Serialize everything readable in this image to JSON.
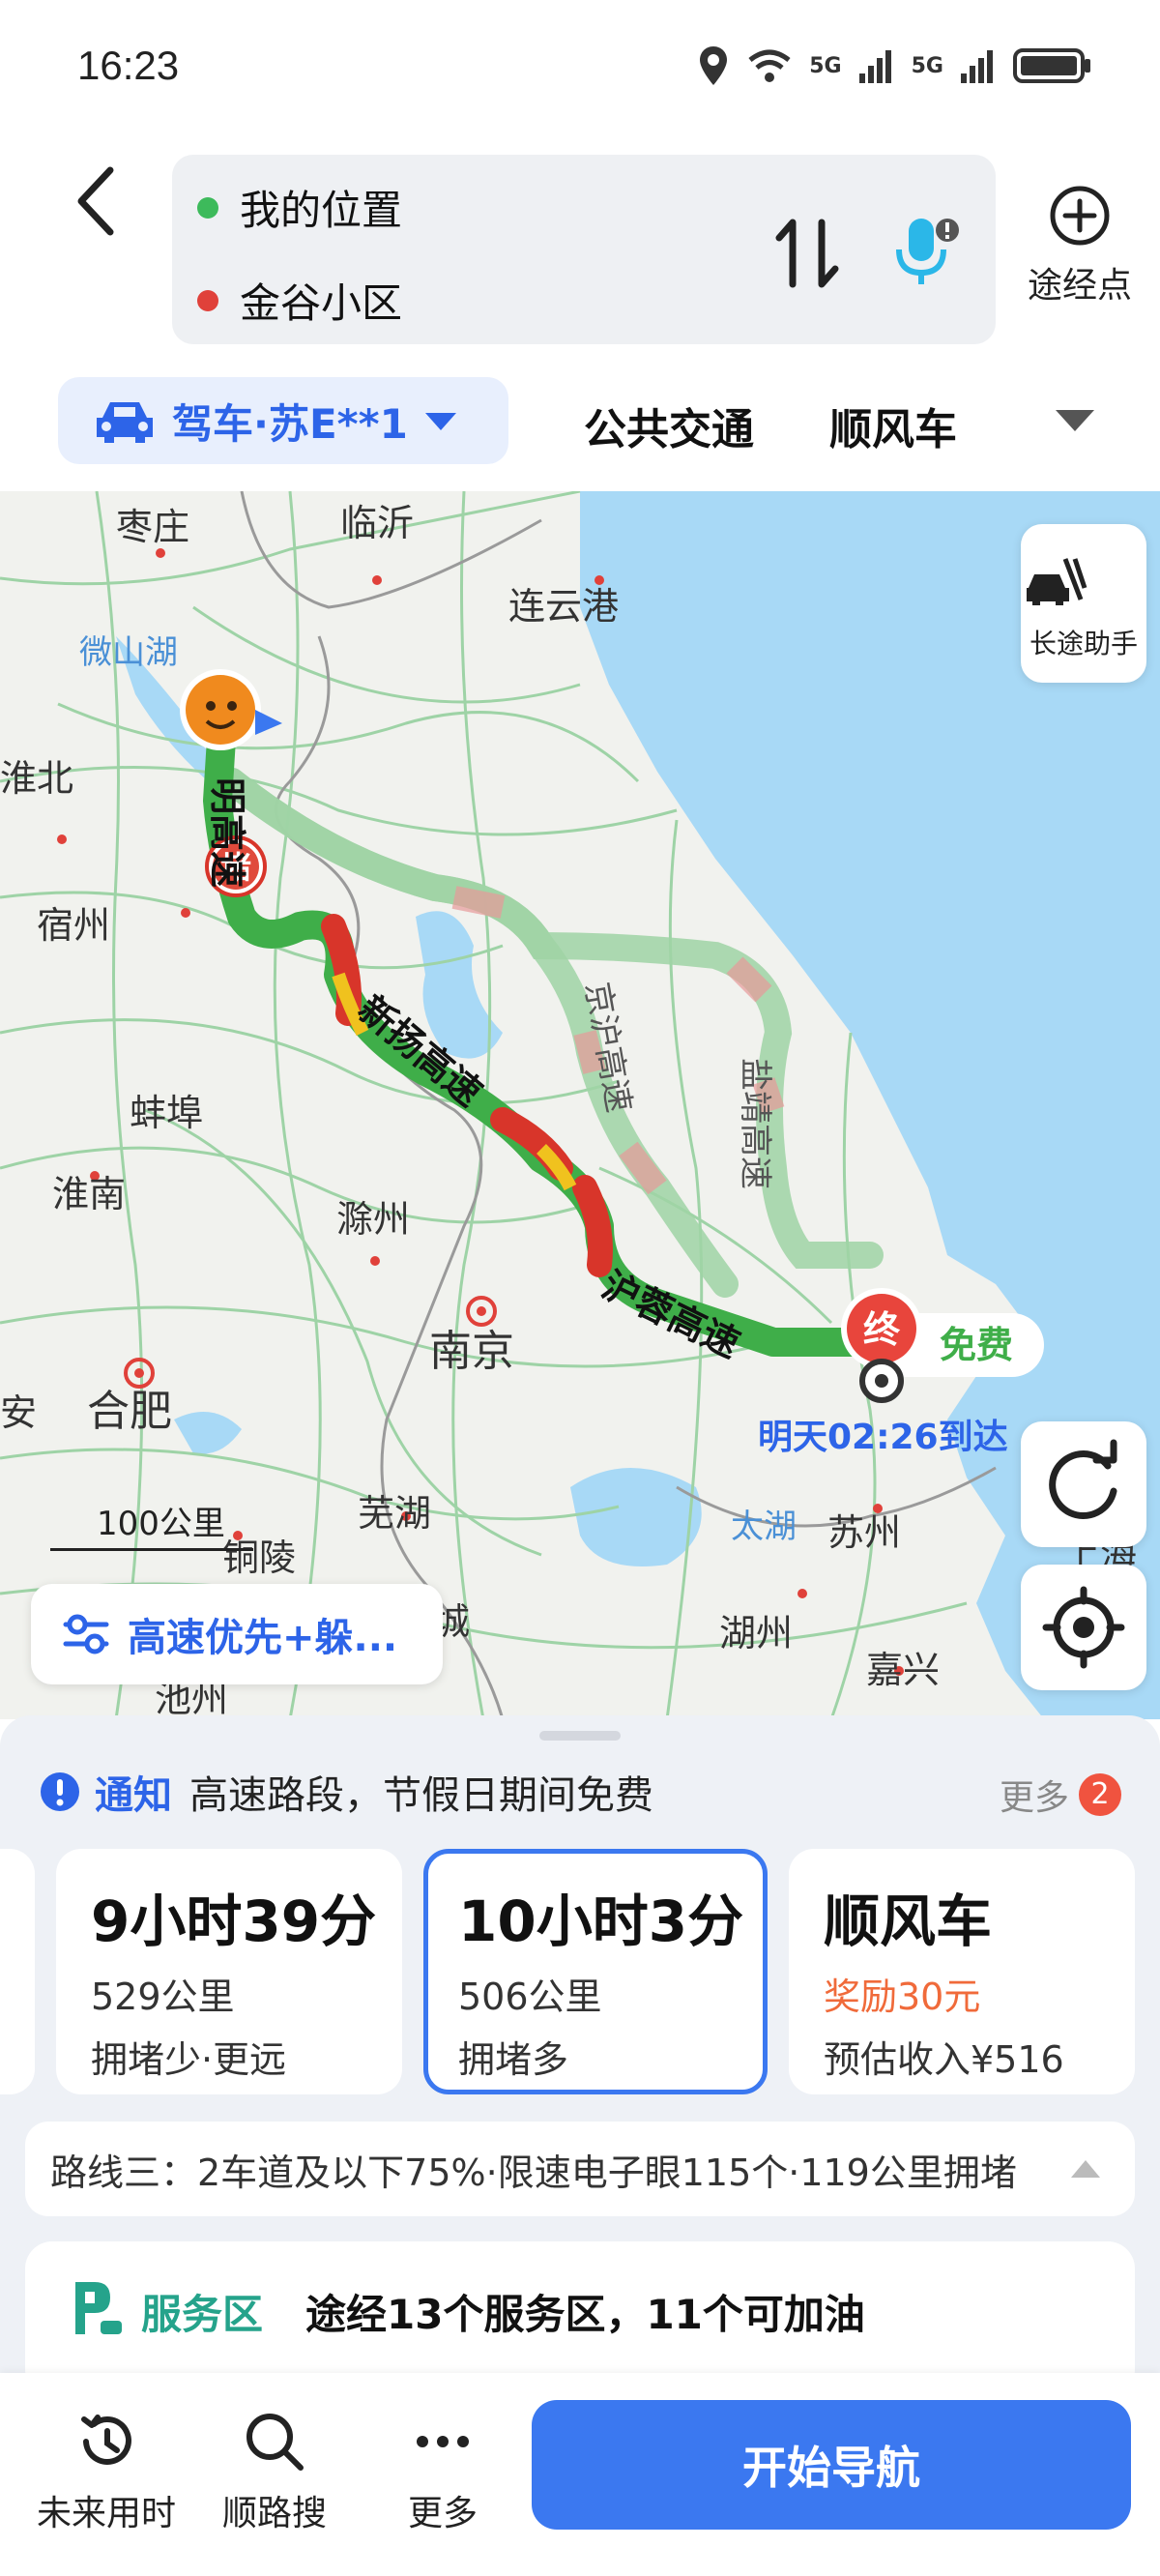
{
  "status_bar": {
    "time": "16:23",
    "network_1": "5G",
    "network_2": "5G"
  },
  "header": {
    "origin": "我的位置",
    "destination": "金谷小区",
    "waypoint_label": "途经点"
  },
  "mode_tabs": {
    "car": "驾车·苏E**1",
    "transit": "公共交通",
    "rideshare": "顺风车"
  },
  "map": {
    "long_trip_label": "长途助手",
    "scale_label": "100公里",
    "preference_label": "高速优先+躲...",
    "arrival_label": "明天02:26到达",
    "end_marker": "终",
    "free_tag": "免费",
    "jam_marker": "堵",
    "cities": {
      "zaozhuang": "枣庄",
      "linyi": "临沂",
      "weishanhu": "微山湖",
      "lianyungang": "连云港",
      "huaibei": "淮北",
      "suzhou_ah": "宿州",
      "bengbu": "蚌埠",
      "huainan": "淮南",
      "chuzhou": "滁州",
      "nanjing": "南京",
      "hefei": "合肥",
      "wuhu": "芜湖",
      "tongling": "铜陵",
      "xuancheng": "宣城",
      "huzhou": "湖州",
      "jiaxing": "嘉兴",
      "suzhou_js": "苏州",
      "taihu": "太湖",
      "shanghai": "上海",
      "an": "安",
      "chizhou": "池州"
    },
    "roads": {
      "ming_express": "明高速",
      "xinyang": "新扬高速",
      "jinghu": "京沪高速",
      "yanjing": "盐靖高速",
      "hurong": "沪蓉高速"
    }
  },
  "sheet": {
    "notice_title": "通知",
    "notice_text": "高速路段，节假日期间免费",
    "notice_more": "更多",
    "notice_count": "2",
    "routes": [
      {
        "time": "9小时39分",
        "distance": "529公里",
        "note": "拥堵少·更远"
      },
      {
        "time": "10小时3分",
        "distance": "506公里",
        "note": "拥堵多"
      }
    ],
    "rideshare_card": {
      "title": "顺风车",
      "reward": "奖励30元",
      "income": "预估收入¥516"
    },
    "route_info": "路线三：2车道及以下75%·限速电子眼115个·119公里拥堵",
    "service_title": "服务区",
    "service_text": "途经13个服务区，11个可加油"
  },
  "bottom_bar": {
    "future_time": "未来用时",
    "along_search": "顺路搜",
    "more": "更多",
    "start_nav": "开始导航"
  },
  "colors": {
    "accent": "#3b78f0",
    "route_green": "#3fae49",
    "jam_red": "#d8352a",
    "service_green": "#25a38b"
  }
}
